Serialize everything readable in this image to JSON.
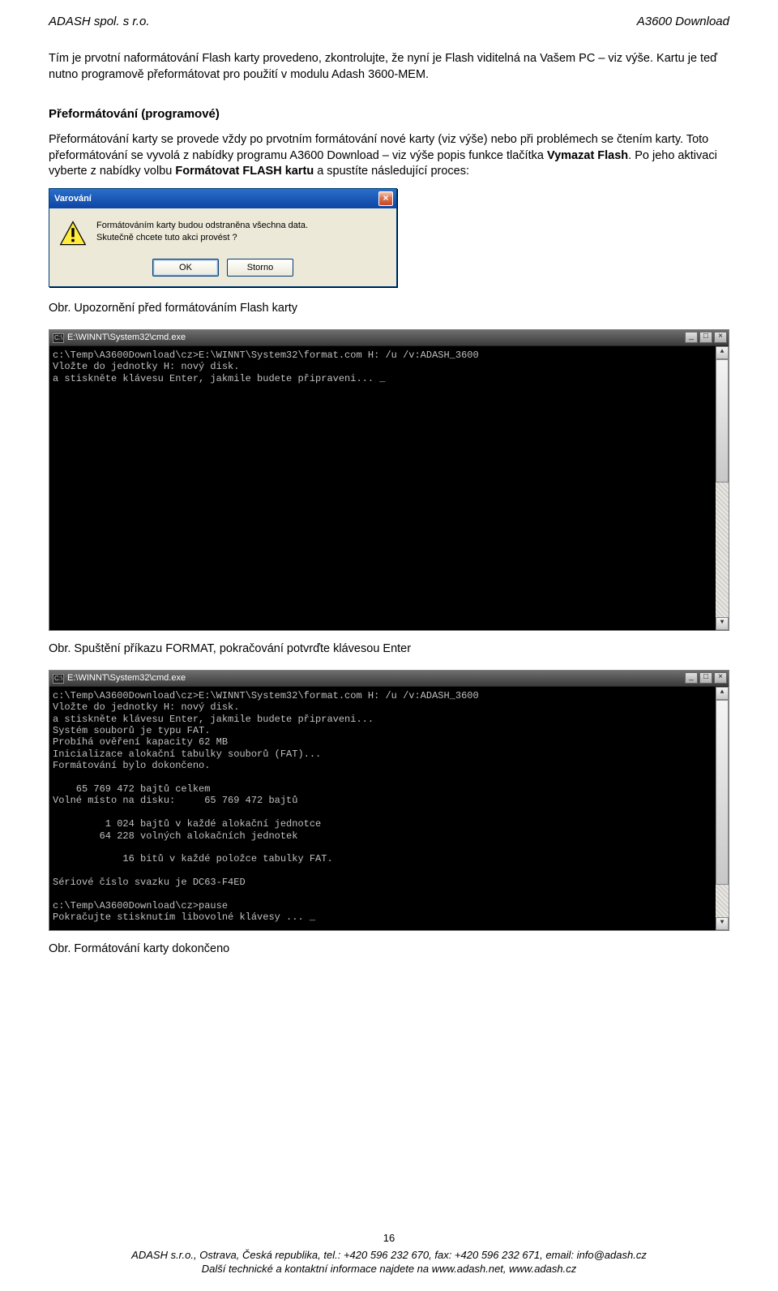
{
  "header": {
    "left": "ADASH spol. s r.o.",
    "right": "A3600 Download"
  },
  "p1": "Tím je prvotní naformátování Flash karty provedeno, zkontrolujte, že nyní je Flash viditelná na Vašem PC – viz výše. Kartu je teď nutno programově přeformátovat pro použití v modulu Adash 3600-MEM.",
  "h2": "Přeformátování (programové)",
  "p2a": " Přeformátování karty se provede vždy po prvotním formátování nové karty (viz výše) nebo při problémech se čtením karty. Toto přeformátování se vyvolá z nabídky programu A3600 Download – viz výše popis funkce tlačítka ",
  "p2b": "Vymazat Flash",
  "p2c": ". Po jeho aktivaci vyberte z nabídky volbu ",
  "p2d": "Formátovat FLASH kartu",
  "p2e": " a spustíte následující proces:",
  "dialog": {
    "title": "Varování",
    "close": "×",
    "line1": "Formátováním karty budou odstraněna všechna data.",
    "line2": "Skutečně chcete tuto akci provést ?",
    "ok": "OK",
    "cancel": "Storno"
  },
  "caption1": "Obr. Upozornění před formátováním Flash karty",
  "console1": {
    "title": "E:\\WINNT\\System32\\cmd.exe",
    "text": "c:\\Temp\\A3600Download\\cz>E:\\WINNT\\System32\\format.com H: /u /v:ADASH_3600\nVložte do jednotky H: nový disk.\na stiskněte klávesu Enter, jakmile budete připraveni... _"
  },
  "caption2": "Obr. Spuštění příkazu FORMAT, pokračování potvrďte klávesou Enter",
  "console2": {
    "title": "E:\\WINNT\\System32\\cmd.exe",
    "text": "c:\\Temp\\A3600Download\\cz>E:\\WINNT\\System32\\format.com H: /u /v:ADASH_3600\nVložte do jednotky H: nový disk.\na stiskněte klávesu Enter, jakmile budete připraveni...\nSystém souborů je typu FAT.\nProbíhá ověření kapacity 62 MB\nInicializace alokační tabulky souborů (FAT)...\nFormátování bylo dokončeno.\n\n    65 769 472 bajtů celkem\nVolné místo na disku:     65 769 472 bajtů\n\n         1 024 bajtů v každé alokační jednotce\n        64 228 volných alokačních jednotek\n\n            16 bitů v každé položce tabulky FAT.\n\nSériové číslo svazku je DC63-F4ED\n\nc:\\Temp\\A3600Download\\cz>pause\nPokračujte stisknutím libovolné klávesy ... _"
  },
  "caption3": "Obr. Formátování karty dokončeno",
  "footer": {
    "pagenum": "16",
    "line1": "ADASH s.r.o., Ostrava, Česká republika, tel.: +420 596 232 670, fax: +420 596 232 671, email: info@adash.cz",
    "line2": "Další technické a kontaktní informace najdete na www.adash.net, www.adash.cz"
  },
  "scroll": {
    "up": "▲",
    "down": "▼"
  },
  "winctrl": {
    "min": "_",
    "max": "□",
    "close": "×"
  },
  "conicon": "C:\\"
}
